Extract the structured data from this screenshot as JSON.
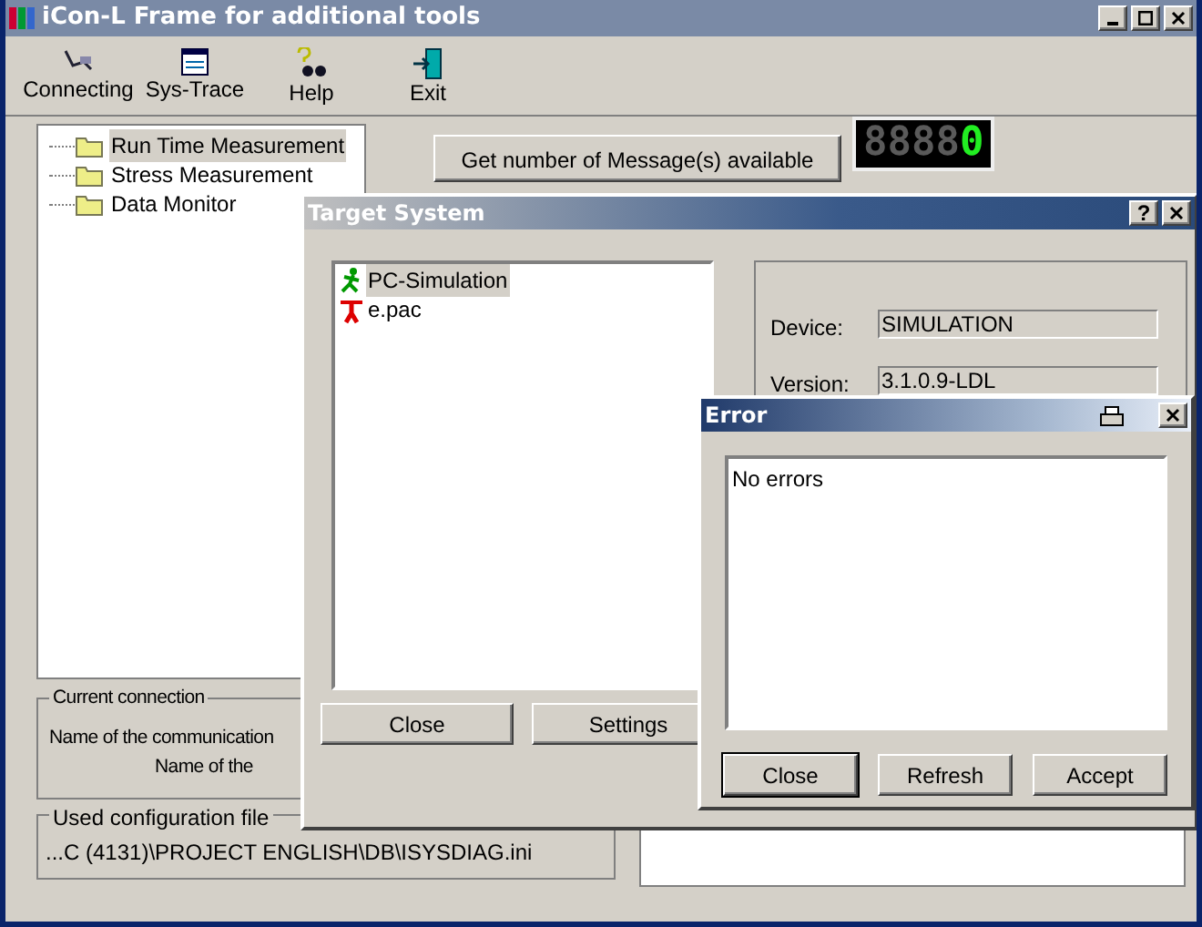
{
  "window": {
    "title": "iCon-L Frame for additional tools"
  },
  "toolbar": [
    {
      "label": "Connecting",
      "kind": "connect"
    },
    {
      "label": "Sys-Trace",
      "kind": "trace"
    },
    {
      "label": "Help",
      "kind": "help"
    },
    {
      "label": "Exit",
      "kind": "exit"
    }
  ],
  "tree": [
    {
      "label": "Run Time Measurement",
      "selected": true
    },
    {
      "label": "Stress Measurement",
      "selected": false
    },
    {
      "label": "Data Monitor",
      "selected": false
    }
  ],
  "message_button": "Get number of Message(s) available",
  "counter": {
    "unlit": "8888",
    "value": "0"
  },
  "current_connection": {
    "title": "Current connection",
    "lines": [
      "Name of the communication",
      "Name of the"
    ]
  },
  "config_file": {
    "title": "Used configuration file",
    "path": "...C (4131)\\PROJECT ENGLISH\\DB\\ISYSDIAG.ini"
  },
  "target_dialog": {
    "title": "Target System",
    "help": "?",
    "targets": [
      {
        "label": "PC-Simulation",
        "kind": "running",
        "selected": true
      },
      {
        "label": "e.pac",
        "kind": "stopped",
        "selected": false
      }
    ],
    "fields": [
      {
        "label": "Device:",
        "value": "SIMULATION"
      },
      {
        "label": "Version:",
        "value": "3.1.0.9-LDL"
      }
    ],
    "buttons": [
      "Close",
      "Settings"
    ]
  },
  "error_dialog": {
    "title": "Error",
    "messages": [
      "No errors"
    ],
    "buttons": [
      {
        "label": "Close",
        "default": true
      },
      {
        "label": "Refresh",
        "default": false
      },
      {
        "label": "Accept",
        "default": false
      }
    ]
  }
}
